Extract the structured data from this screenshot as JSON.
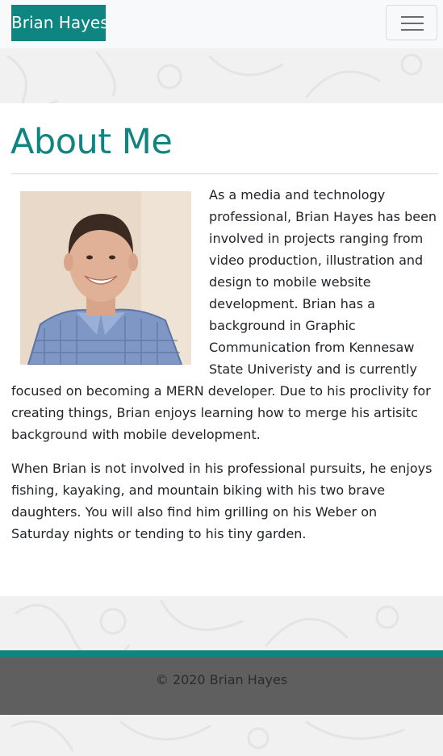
{
  "navbar": {
    "brand": "Brian Hayes",
    "toggle_icon": "hamburger-menu-icon"
  },
  "main": {
    "title": "About Me",
    "photo_alt": "Photo of Brian Hayes",
    "paragraphs": [
      "As a media and technology professional, Brian Hayes has been involved in projects ranging from video production, illustration and design to mobile website development. Brian has a background in Graphic Communication from Kennesaw State Univeristy and is currently focused on becoming a MERN developer. Due to his proclivity for creating things, Brian enjoys learning how to merge his artisitc background with mobile development.",
      "When Brian is not involved in his professional pursuits, he enjoys fishing, kayaking, and mountain biking with his two brave daughters. You will also find him grilling on his Weber on Saturday nights or tending to his tiny garden."
    ]
  },
  "footer": {
    "copyright": "© 2020 Brian Hayes"
  },
  "colors": {
    "accent": "#0e8580",
    "footer_bg": "#5f5f5f",
    "page_bg": "#f1f1f1"
  }
}
